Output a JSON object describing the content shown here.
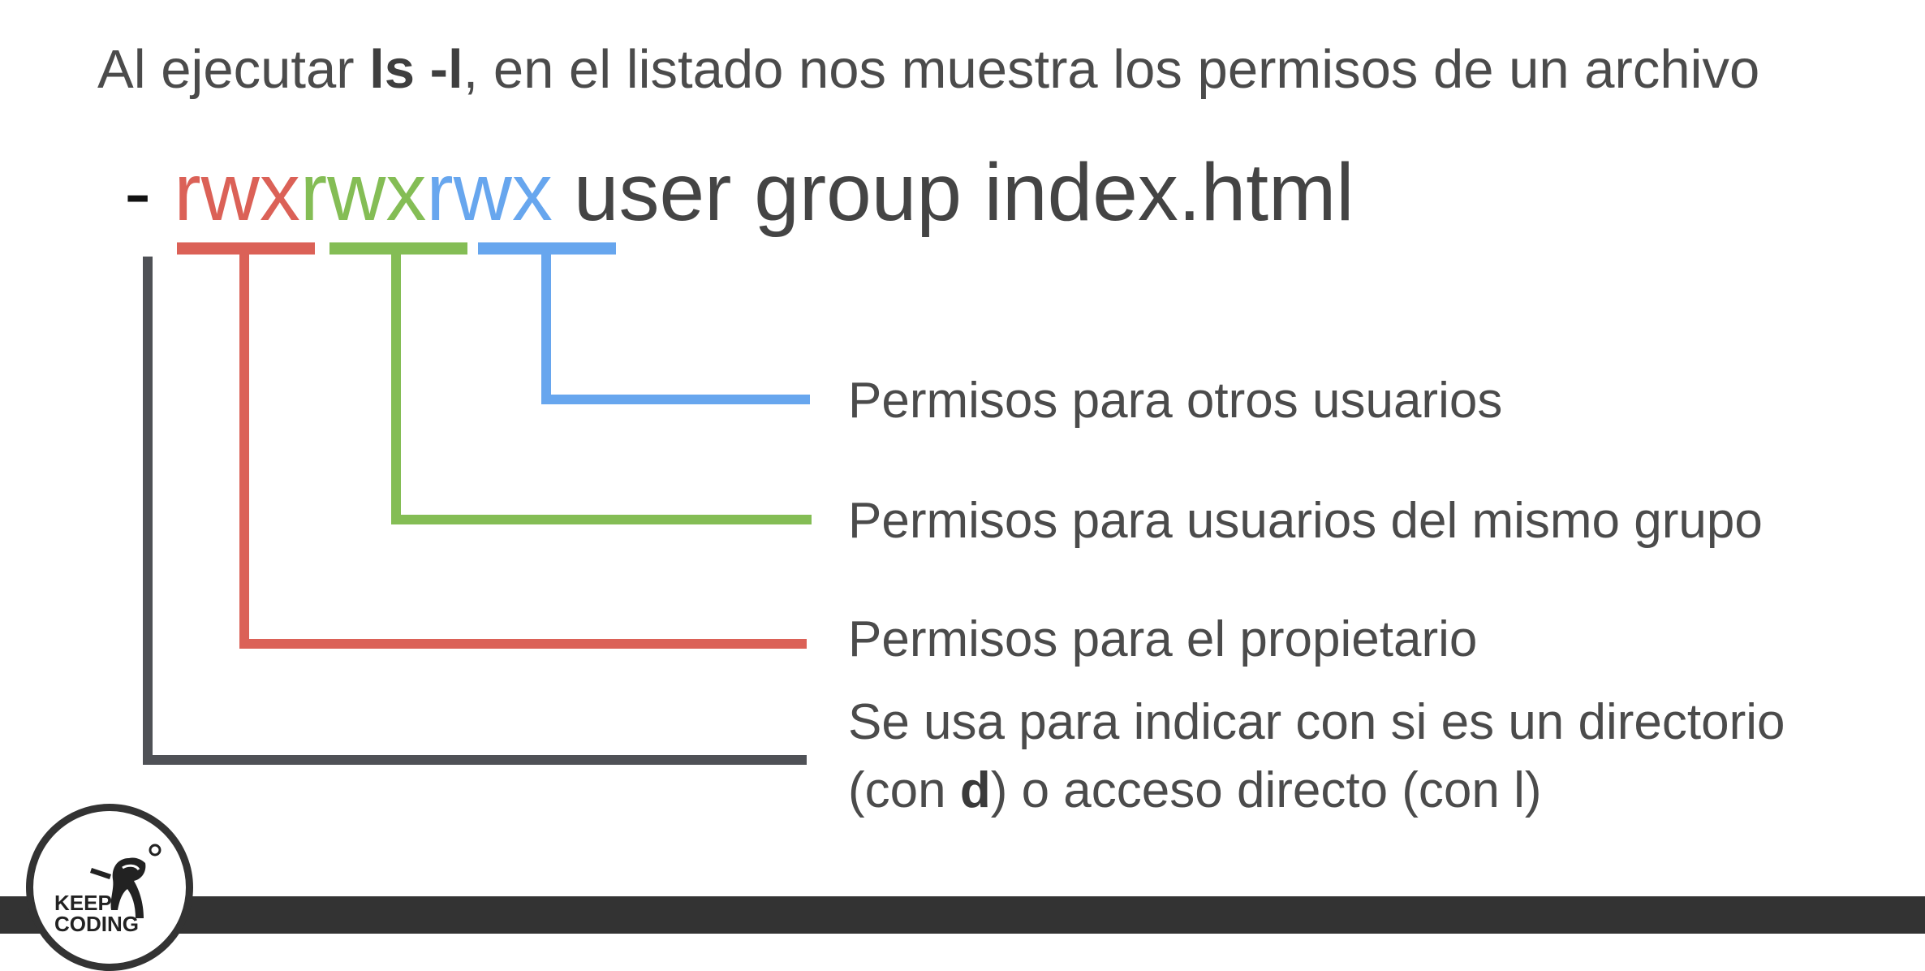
{
  "intro": {
    "before": "Al ejecutar ",
    "command": "ls -l",
    "after": ", en el listado nos muestra los permisos de un archivo"
  },
  "permission_line": {
    "type_char": "-",
    "owner": "rwx",
    "group": "rwx",
    "others": "rwx",
    "rest": "user group index.html"
  },
  "labels": {
    "others": "Permisos para otros usuarios",
    "group": "Permisos para usuarios del mismo grupo",
    "owner": "Permisos para el propietario",
    "type_line1": "Se usa para indicar con si es un directorio",
    "type_line2_a": "(con ",
    "type_line2_b": "d",
    "type_line2_c": ") o acceso directo (con l)"
  },
  "logo": {
    "line1": "KEEP",
    "line2": "CODING"
  },
  "colors": {
    "owner": "#db6157",
    "group": "#84bd55",
    "others": "#67a6ee",
    "type": "#4f5156",
    "footer": "#333333"
  }
}
